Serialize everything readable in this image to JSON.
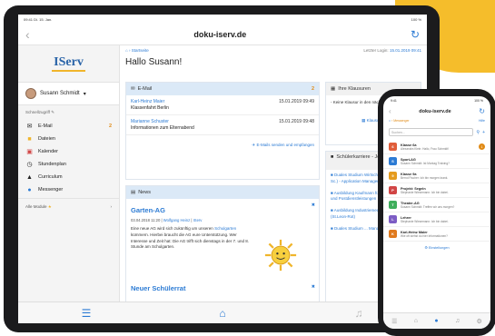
{
  "colors": {
    "accent": "#2c7bd4",
    "brand_yellow": "#f5bd2b",
    "count": "#e08a15"
  },
  "tablet": {
    "status_left": "09:41 Di. 15. Jan.",
    "status_right": "100 %",
    "url": "doku-iserv.de",
    "logo": "IServ",
    "user_name": "Susann Schmidt",
    "quicklinks_label": "Schnellzugriff",
    "nav": [
      {
        "label": "E-Mail",
        "icon": "mail-icon",
        "count": "2"
      },
      {
        "label": "Dateien",
        "icon": "folder-icon",
        "count": ""
      },
      {
        "label": "Kalender",
        "icon": "calendar-icon",
        "count": ""
      },
      {
        "label": "Stundenplan",
        "icon": "clock-icon",
        "count": ""
      },
      {
        "label": "Curriculum",
        "icon": "graduation-icon",
        "count": ""
      },
      {
        "label": "Messenger",
        "icon": "chat-icon",
        "count": ""
      }
    ],
    "all_modules": "Alle Module",
    "breadcrumb": "Startseite",
    "last_login_label": "Letzter Login:",
    "last_login_value": "15.01.2019 09:41",
    "greeting": "Hallo Susann!",
    "email_panel": {
      "title": "E-Mail",
      "count": "2",
      "items": [
        {
          "from": "Karl-Heinz Maier",
          "subject": "Klassenfahrt Berlin",
          "date": "15.01.2019 09:49"
        },
        {
          "from": "Marianne Schuster",
          "subject": "Informationen zum Elternabend",
          "date": "15.01.2019 09:48"
        }
      ],
      "link": "E-Mails senden und empfangen"
    },
    "news_panel": {
      "title": "News",
      "headline": "Garten-AG",
      "meta_date": "03.04.2018 11:20",
      "meta_author": "Wolfgang Heinz",
      "meta_tag": "IServ",
      "body_1": "Eine neue AG wird sich zukünftig um unseren",
      "body_link": "Schulgarten",
      "body_2": "kümmern. Hierbei braucht die AG eure Unterstützung. Wer Interesse und Zeit hat: Die AG trifft sich dienstags in der 7. und 8. Stunde am Schulgarten.",
      "headline2": "Neuer Schülerrat"
    },
    "exams_panel": {
      "title": "Ihre Klausuren",
      "text": "- Keine Klausur in den nächsten 14 Tagen -",
      "link": "Klausuren"
    },
    "jobs_panel": {
      "title": "Schülerkarriere - Jobangebote",
      "items": [
        "Duales Studium Wirtschaftsinformatik (B. Sc.) - Application Management",
        "Ausbildung Kaufmann für Kurier-, Express- und Postdienstleistungen",
        "Ausbildung Industriemechaniker 2020 (St.Leon-Rot)",
        "Duales Studium ... Management"
      ]
    }
  },
  "phone": {
    "status_left": "9:41",
    "status_right": "100 %",
    "url": "doku-iserv.de",
    "crumb": "Messenger",
    "crumb_right": "Hilfe",
    "search_placeholder": "Suchen...",
    "items": [
      {
        "abbr": "6",
        "color": "#e05d3a",
        "title": "Klasse 6a",
        "sub": "Alexandra Klein: Hallo, Frau Schmidt!",
        "badge": "1"
      },
      {
        "abbr": "S",
        "color": "#2c7bd4",
        "title": "Sport-AG",
        "sub": "Susann Schmidt: Ist Montag Training?",
        "badge": ""
      },
      {
        "abbr": "9",
        "color": "#e59b1e",
        "title": "Klasse 9a",
        "sub": "Bernd Fischer: Ich bin morgen krank.",
        "badge": ""
      },
      {
        "abbr": "P",
        "color": "#d14545",
        "title": "Projekt: Segeln",
        "sub": "Stephanie Wiesemann: Ich bin dabei.",
        "badge": ""
      },
      {
        "abbr": "T",
        "color": "#3fae5c",
        "title": "Theater-AG",
        "sub": "Susann Schmidt: Treffen wir uns morgen?",
        "badge": ""
      },
      {
        "abbr": "L",
        "color": "#7c5cc4",
        "title": "Lehrer",
        "sub": "Stephanie Wiesemann: Ich bin dabei.",
        "badge": ""
      },
      {
        "abbr": "K",
        "color": "#e07a1e",
        "title": "Karl-Heinz Maier",
        "sub": "Wie oft siehst du hier Informationen?",
        "badge": ""
      }
    ],
    "footer": "Einstellungen"
  }
}
